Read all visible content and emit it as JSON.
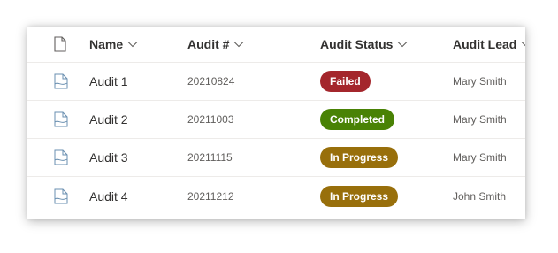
{
  "columns": {
    "type_icon": "document-icon",
    "name": "Name",
    "audit_number": "Audit #",
    "audit_status": "Audit Status",
    "audit_lead": "Audit Lead"
  },
  "rows": [
    {
      "icon": "page-icon",
      "name": "Audit 1",
      "audit_number": "20210824",
      "status": "Failed",
      "status_color": "#a4262c",
      "lead": "Mary Smith"
    },
    {
      "icon": "page-icon",
      "name": "Audit 2",
      "audit_number": "20211003",
      "status": "Completed",
      "status_color": "#498205",
      "lead": "Mary Smith"
    },
    {
      "icon": "page-icon",
      "name": "Audit 3",
      "audit_number": "20211115",
      "status": "In Progress",
      "status_color": "#986f0b",
      "lead": "Mary Smith"
    },
    {
      "icon": "page-icon",
      "name": "Audit 4",
      "audit_number": "20211212",
      "status": "In Progress",
      "status_color": "#986f0b",
      "lead": "John Smith"
    }
  ]
}
